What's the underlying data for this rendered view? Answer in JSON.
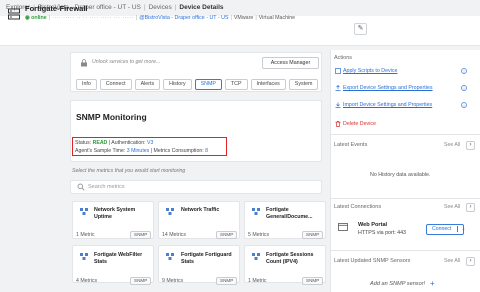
{
  "breadcrumb": [
    "Explorer",
    "BistroVista - Draper office - UT - US",
    "Devices",
    "Device Details"
  ],
  "device": {
    "name": "Fortigate-Firewall",
    "status": "online",
    "obscured_id": "···· ····· ·· ·· ···· ····· ··· ·····",
    "location": "@BistroVista - Draper office - UT - US",
    "vendor": "VMware",
    "type": "Virtual Machine"
  },
  "services": {
    "unlock_text": "Unlock services to get more...",
    "access_button": "Access Manager",
    "tabs": [
      "Info",
      "Connect",
      "Alerts",
      "History",
      "SNMP",
      "TCP",
      "Interfaces",
      "System"
    ],
    "active_tab": "SNMP"
  },
  "snmp": {
    "title": "SNMP Monitoring",
    "status_label": "Status:",
    "status_value": "READ",
    "auth_label": "| Authentication:",
    "auth_value": "V3",
    "sample_label": "Agent's Sample Time:",
    "sample_value": "3 Minutes",
    "consumption_label": "| Metrics Consumption:",
    "consumption_value": "8"
  },
  "metrics_section": {
    "prompt": "Select the metrics that you would start monitoring",
    "search_placeholder": "Search metrics",
    "cards": [
      {
        "title": "Network System Uptime",
        "count": "1 Metric",
        "badge": "SNMP"
      },
      {
        "title": "Network Traffic",
        "count": "14 Metrics",
        "badge": "SNMP"
      },
      {
        "title": "Fortigate General/Docume...",
        "count": "5 Metrics",
        "badge": "SNMP"
      },
      {
        "title": "Fortigate WebFilter Stats",
        "count": "4 Metrics",
        "badge": "SNMP"
      },
      {
        "title": "Fortigate Fortiguard Stats",
        "count": "9 Metrics",
        "badge": "SNMP"
      },
      {
        "title": "Fortigate Sessions Count (IPV4)",
        "count": "1 Metric",
        "badge": "SNMP"
      }
    ]
  },
  "actions": {
    "heading": "Actions",
    "items": [
      "Apply Scripts to Device",
      "Export Device Settings and Properties",
      "Import Device Settings and Properties"
    ],
    "delete_label": "Delete Device"
  },
  "latest_events": {
    "heading": "Latest Events",
    "see_all": "See All",
    "empty": "No History data available."
  },
  "latest_connections": {
    "heading": "Latest Connections",
    "see_all": "See All",
    "item_title": "Web Portal",
    "item_sub": "HTTPS via port: 443",
    "connect_label": "Connect"
  },
  "latest_sensors": {
    "heading": "Latest Updated SNMP Sensors",
    "see_all": "See All",
    "add_label": "Add an SNMP sensor!"
  },
  "colors": {
    "accent": "#2a6fd6",
    "online": "#2e9b3a",
    "danger": "#d9302e",
    "highlight_box": "#e02424"
  }
}
